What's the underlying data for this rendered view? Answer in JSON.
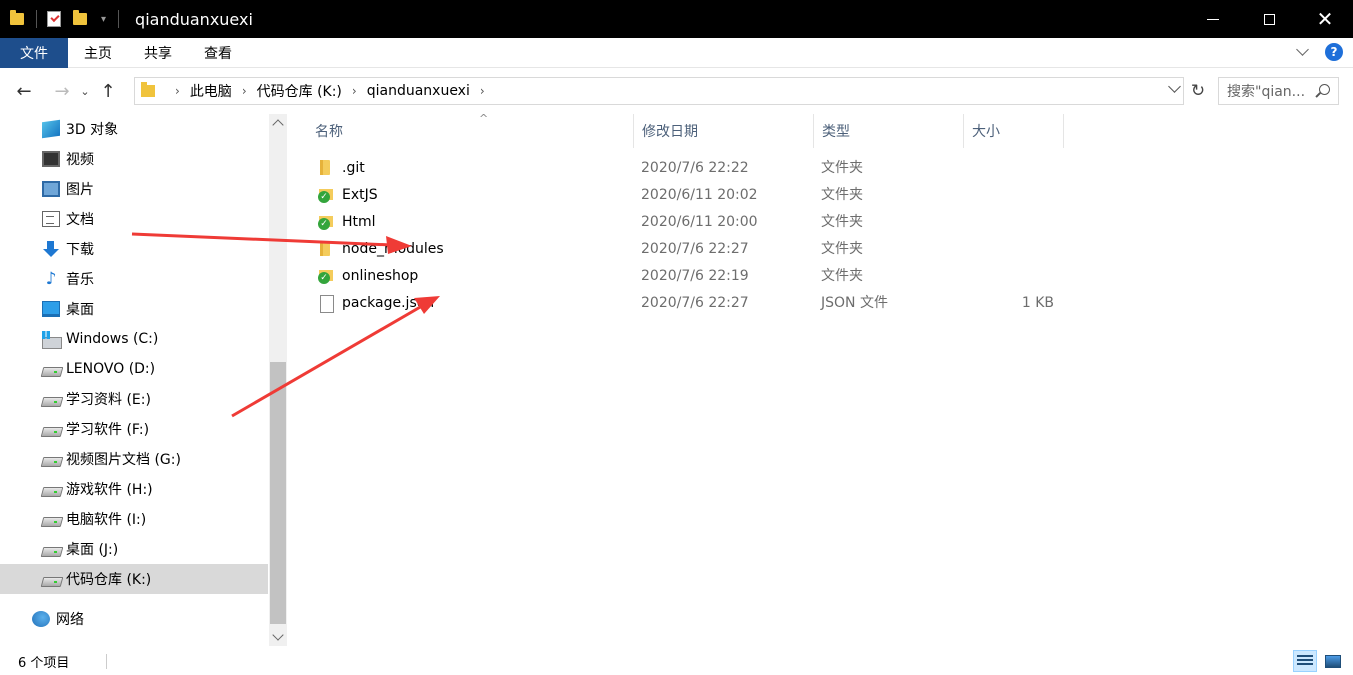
{
  "window": {
    "title": "qianduanxuexi"
  },
  "ribbon": {
    "tabs": [
      "文件",
      "主页",
      "共享",
      "查看"
    ]
  },
  "address": {
    "crumbs": [
      "此电脑",
      "代码仓库 (K:)",
      "qianduanxuexi"
    ],
    "search_placeholder": "搜索\"qian...",
    "search_icon": "magnifier-icon"
  },
  "navpane": {
    "items": [
      {
        "label": "3D 对象",
        "icon": "3d-objects-icon"
      },
      {
        "label": "视频",
        "icon": "video-icon"
      },
      {
        "label": "图片",
        "icon": "pictures-icon"
      },
      {
        "label": "文档",
        "icon": "documents-icon"
      },
      {
        "label": "下载",
        "icon": "downloads-icon"
      },
      {
        "label": "音乐",
        "icon": "music-icon"
      },
      {
        "label": "桌面",
        "icon": "desktop-icon"
      },
      {
        "label": "Windows (C:)",
        "icon": "windows-drive-icon"
      },
      {
        "label": "LENOVO (D:)",
        "icon": "drive-icon"
      },
      {
        "label": "学习资料 (E:)",
        "icon": "drive-icon"
      },
      {
        "label": "学习软件 (F:)",
        "icon": "drive-icon"
      },
      {
        "label": "视频图片文档 (G:)",
        "icon": "drive-icon"
      },
      {
        "label": "游戏软件 (H:)",
        "icon": "drive-icon"
      },
      {
        "label": "电脑软件 (I:)",
        "icon": "drive-icon"
      },
      {
        "label": "桌面 (J:)",
        "icon": "drive-icon"
      },
      {
        "label": "代码仓库 (K:)",
        "icon": "drive-icon",
        "selected": true
      },
      {
        "label": "网络",
        "icon": "network-icon"
      }
    ]
  },
  "filelist": {
    "columns": [
      "名称",
      "修改日期",
      "类型",
      "大小"
    ],
    "rows": [
      {
        "name": ".git",
        "date": "2020/7/6 22:22",
        "type": "文件夹",
        "size": "",
        "icon": "folder-icon"
      },
      {
        "name": "ExtJS",
        "date": "2020/6/11 20:02",
        "type": "文件夹",
        "size": "",
        "icon": "synced-folder-icon"
      },
      {
        "name": "Html",
        "date": "2020/6/11 20:00",
        "type": "文件夹",
        "size": "",
        "icon": "synced-folder-icon"
      },
      {
        "name": "node_modules",
        "date": "2020/7/6 22:27",
        "type": "文件夹",
        "size": "",
        "icon": "folder-icon"
      },
      {
        "name": "onlineshop",
        "date": "2020/7/6 22:19",
        "type": "文件夹",
        "size": "",
        "icon": "synced-folder-icon"
      },
      {
        "name": "package.json",
        "date": "2020/7/6 22:27",
        "type": "JSON 文件",
        "size": "1 KB",
        "icon": "file-icon"
      }
    ]
  },
  "statusbar": {
    "count": "6 个项目"
  },
  "colors": {
    "accent": "#1e4e8c",
    "annotation_arrow": "#ef3b36",
    "selection": "#d9d9d9"
  }
}
